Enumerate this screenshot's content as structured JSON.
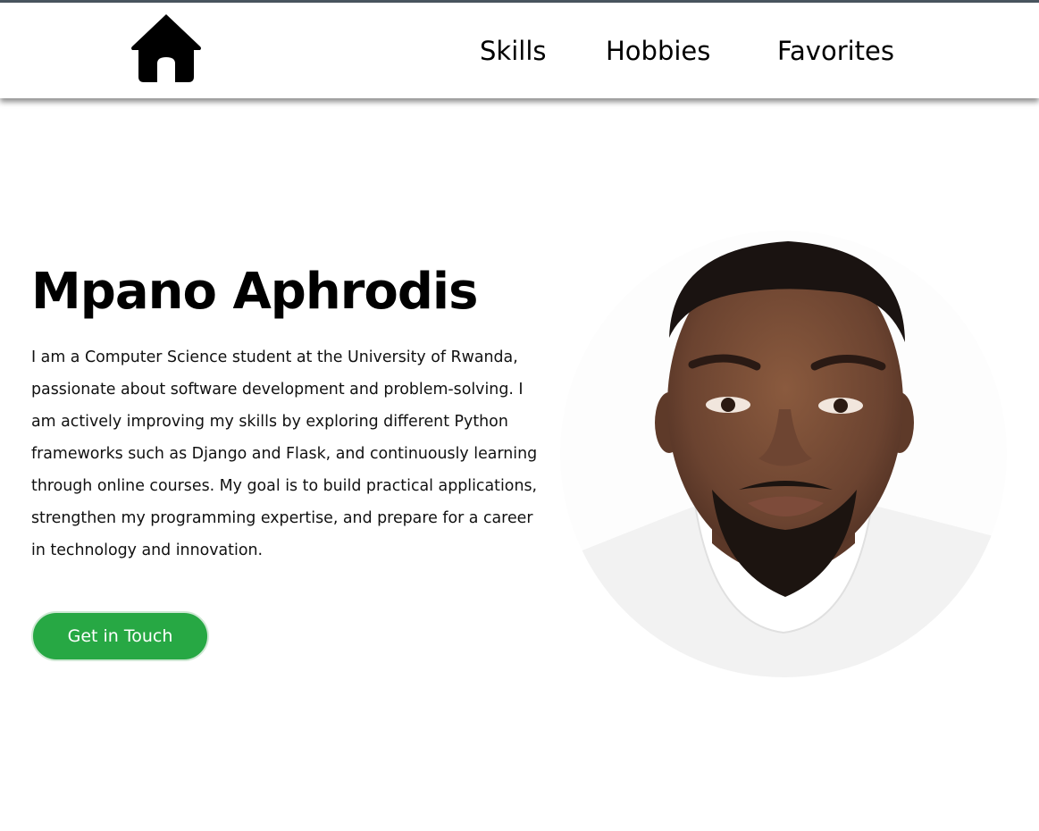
{
  "nav": {
    "home_icon": "home-icon",
    "links": [
      {
        "label": "Skills"
      },
      {
        "label": "Hobbies"
      },
      {
        "label": "Favorites"
      }
    ]
  },
  "hero": {
    "name": "Mpano Aphrodis",
    "bio": "I am a Computer Science student at the University of Rwanda, passionate about software development and problem-solving. I am actively improving my skills by exploring different Python frameworks such as Django and Flask, and continuously learning through online courses. My goal is to build practical applications, strengthen my programming expertise, and prepare for a career in technology and innovation.",
    "cta_label": "Get in Touch",
    "photo_alt": "Profile photo"
  },
  "colors": {
    "top_strip": "#4a5660",
    "cta_background": "#27a844",
    "text": "#000000"
  }
}
